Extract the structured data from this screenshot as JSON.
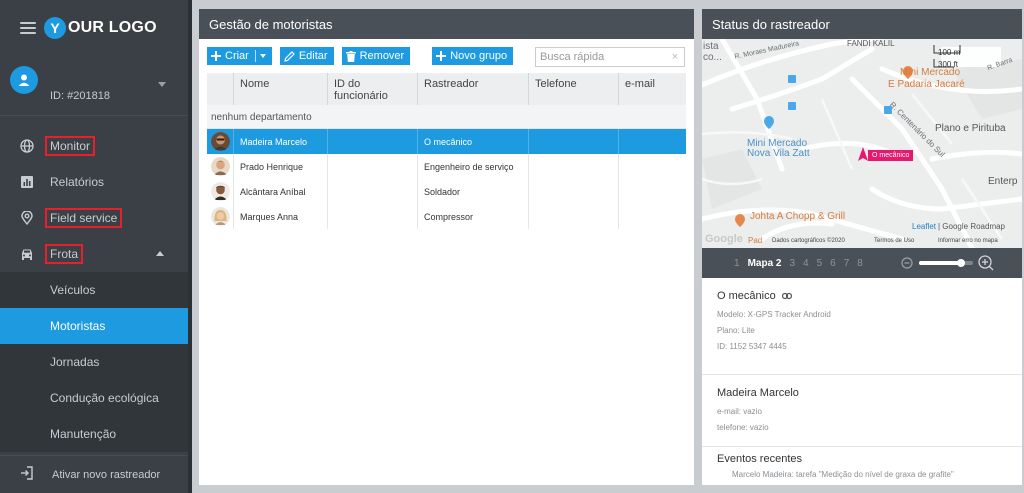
{
  "brand": {
    "logo_letter": "Y",
    "logo_text": "OUR LOGO"
  },
  "user": {
    "id": "ID: #201818"
  },
  "sidebar": {
    "items": [
      {
        "label": "Monitor",
        "icon": "globe-icon",
        "boxed": true
      },
      {
        "label": "Relatórios",
        "icon": "bar-chart-icon",
        "boxed": false
      },
      {
        "label": "Field service",
        "icon": "map-pin-icon",
        "boxed": true
      },
      {
        "label": "Frota",
        "icon": "car-icon",
        "boxed": true
      }
    ],
    "sub_items": [
      "Veículos",
      "Motoristas",
      "Jornadas",
      "Condução ecológica",
      "Manutenção"
    ],
    "active_sub": "Motoristas",
    "bottom_item": "Ativar novo rastreador"
  },
  "drivers_panel": {
    "title": "Gestão de motoristas",
    "toolbar": {
      "create": "Criar",
      "edit": "Editar",
      "remove": "Remover",
      "new_group": "Novo grupo"
    },
    "search": {
      "placeholder": "Busca rápida",
      "clear": "×"
    },
    "columns": [
      "Nome",
      "ID do funcionário",
      "Rastreador",
      "Telefone",
      "e-mail"
    ],
    "department": "nenhum departamento",
    "rows": [
      {
        "name": "Madeira Marcelo",
        "employee_id": "",
        "tracker": "O mecânico",
        "phone": "",
        "email": "",
        "selected": true
      },
      {
        "name": "Prado Henrique",
        "employee_id": "",
        "tracker": "Engenheiro de serviço",
        "phone": "",
        "email": "",
        "selected": false
      },
      {
        "name": "Alcântara Aníbal",
        "employee_id": "",
        "tracker": "Soldador",
        "phone": "",
        "email": "",
        "selected": false
      },
      {
        "name": "Marques Anna",
        "employee_id": "",
        "tracker": "Compressor",
        "phone": "",
        "email": "",
        "selected": false
      }
    ]
  },
  "tracker_panel": {
    "title": "Status do rastreador",
    "map": {
      "labels": {
        "ista": "ista",
        "co": "co...",
        "street_madureira": "R. Moraes Madureira",
        "fandi": "FANDI KALIL",
        "scale_m": "100 m",
        "scale_ft": "300 ft",
        "mini_mercado_padaria": "Mini Mercado",
        "padaria": "E Padaria Jacaré",
        "street_centenario": "R. Centenário do Sul",
        "street_barra": "R. Barra",
        "plano": "Plano e Pirituba",
        "mini_mercado_zatt": "Mini Mercado",
        "zatt": "Nova Vila Zatt",
        "marker": "O mecânico",
        "enterp": "Enterp",
        "johta": "Johta A Chopp & Grill",
        "leaflet": "Leaflet",
        "google_roadmap": "| Google Roadmap",
        "google": "Google",
        "pad": "Pad",
        "map_data": "Dados cartográficos ©2020",
        "terms": "Termos de Uso",
        "report": "Informar erro no mapa"
      }
    },
    "pager": {
      "pages": [
        "1",
        "Mapa 2",
        "3",
        "4",
        "5",
        "6",
        "7",
        "8"
      ],
      "current": "Mapa 2"
    },
    "device": {
      "name": "O mecânico",
      "model": "Modelo: X-GPS Tracker Android",
      "plan": "Plano: Lite",
      "id": "ID: 1152 5347 4445"
    },
    "driver": {
      "name": "Madeira Marcelo",
      "email": "e-mail: vazio",
      "phone": "telefone: vazio"
    },
    "events": {
      "title": "Eventos recentes",
      "first": "Marcelo Madeira: tarefa \"Medição do nível de graxa de grafite\""
    }
  },
  "colors": {
    "accent": "#1e9ae0",
    "sidebar_bg": "#3a4046",
    "header_bg": "#4a5058",
    "highlight_box": "#e8202a",
    "marker": "#e8186e"
  }
}
